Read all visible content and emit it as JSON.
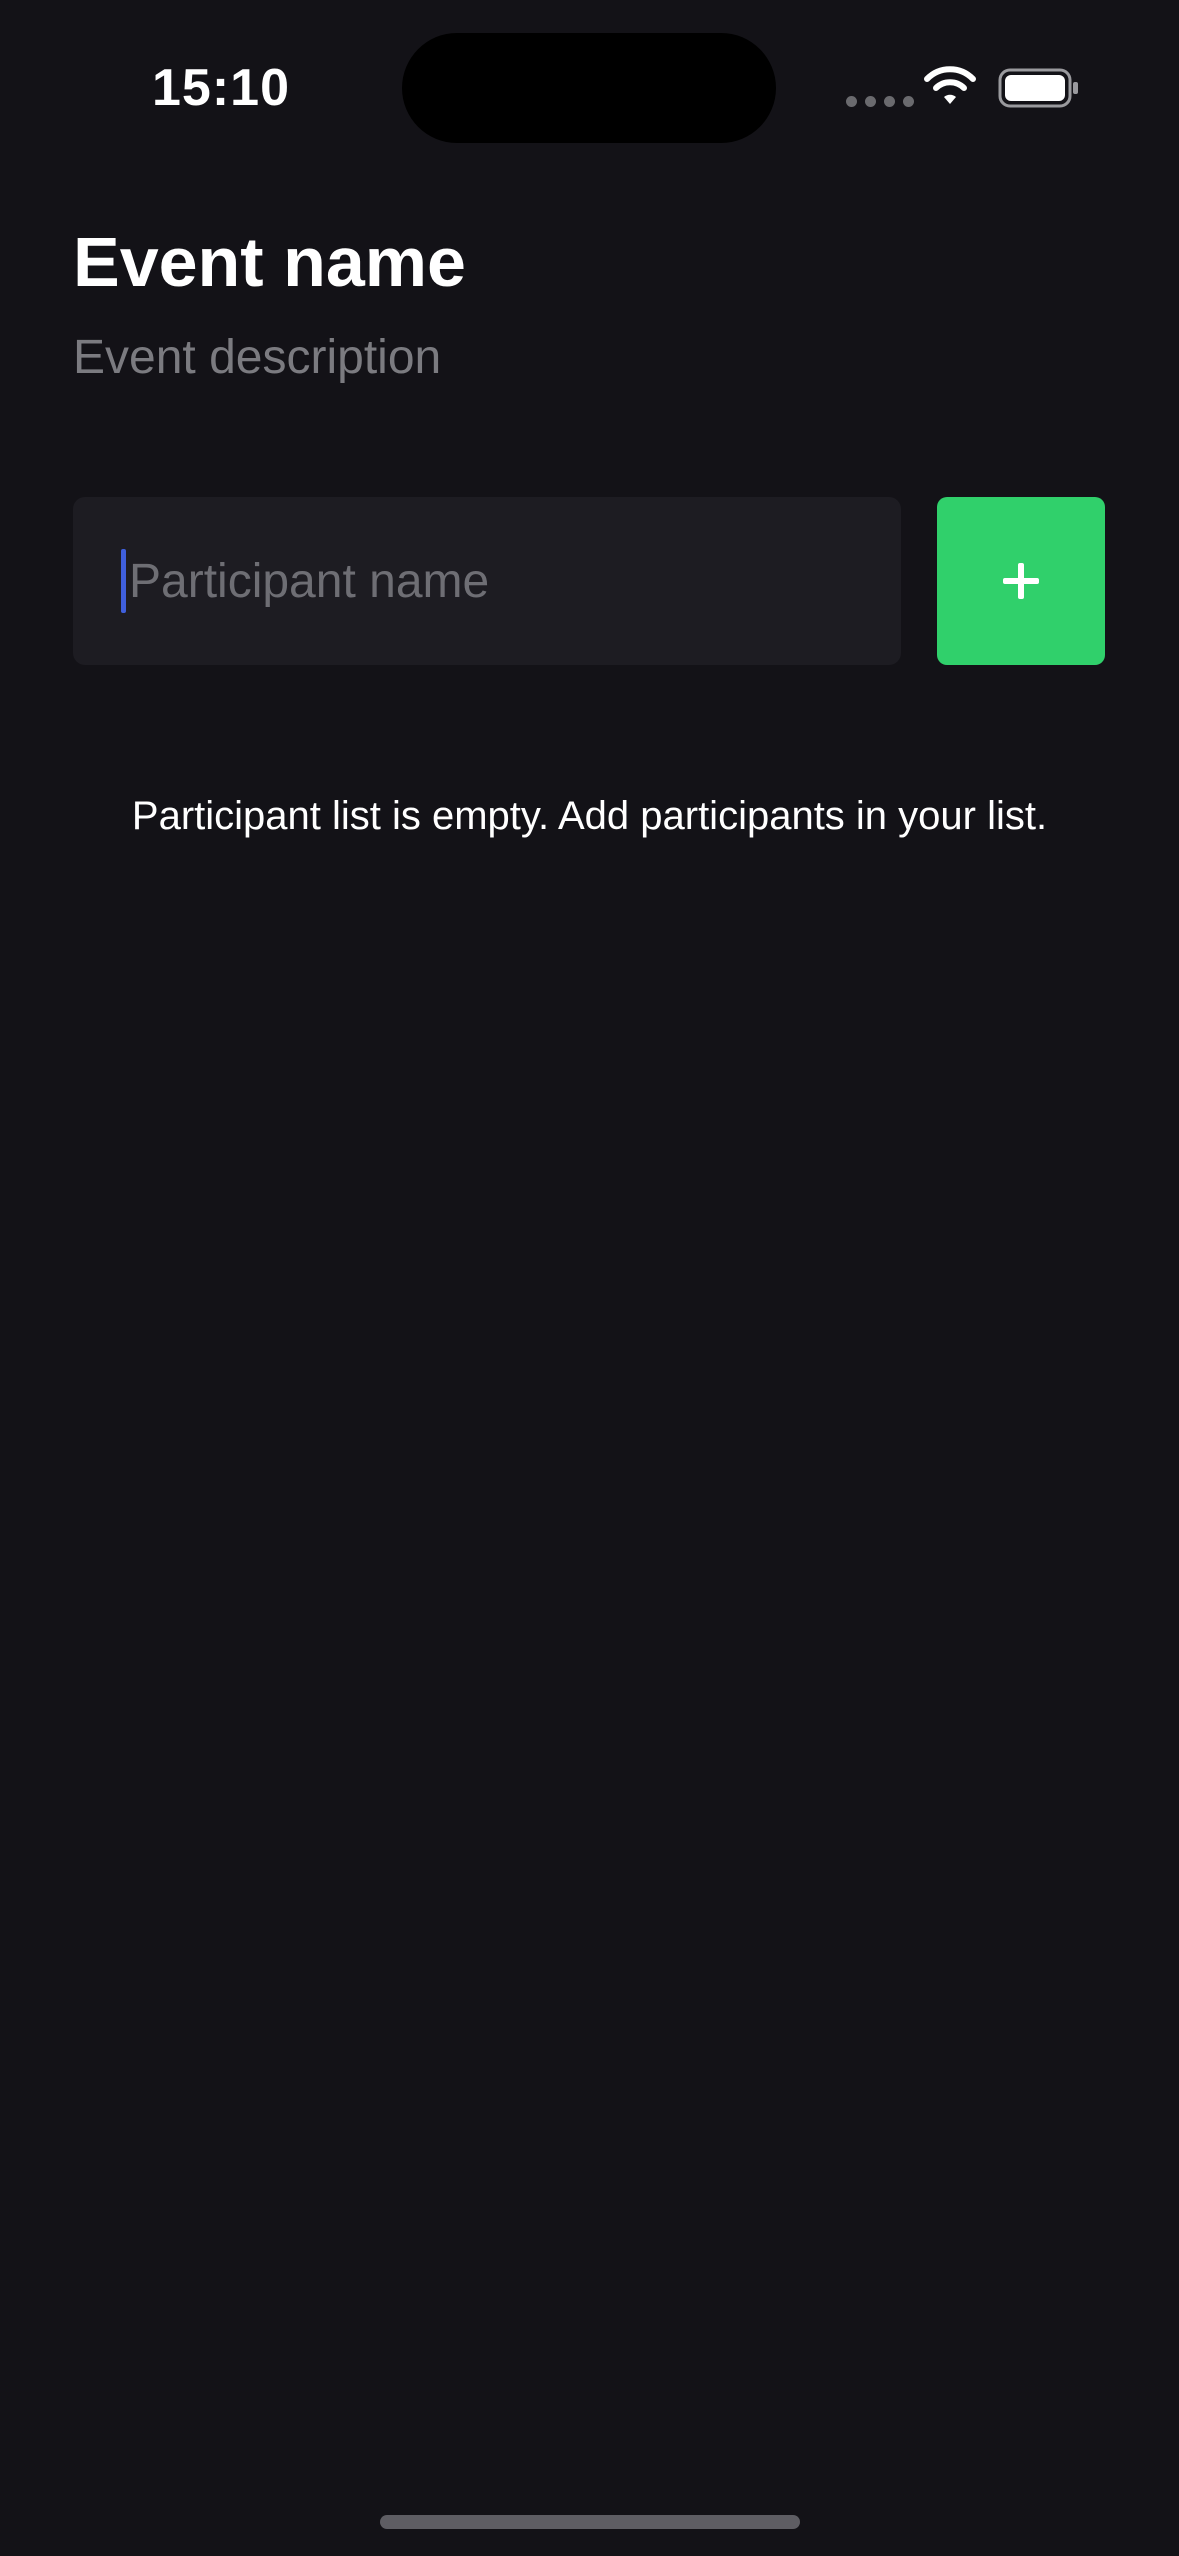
{
  "status_bar": {
    "time": "15:10",
    "icons": [
      "signal-dots-icon",
      "wifi-icon",
      "battery-icon"
    ]
  },
  "header": {
    "event_name": "Event name",
    "event_description": "Event description"
  },
  "participant_form": {
    "input_value": "",
    "input_placeholder": "Participant name",
    "add_button_icon": "plus-icon"
  },
  "participant_list": {
    "empty_message": "Participant list is empty. Add participants in your list."
  },
  "colors": {
    "background": "#131217",
    "input_background": "#1d1c22",
    "accent_green": "#30d06b",
    "caret_blue": "#3f5fdc",
    "secondary_text": "#7b7b80"
  }
}
